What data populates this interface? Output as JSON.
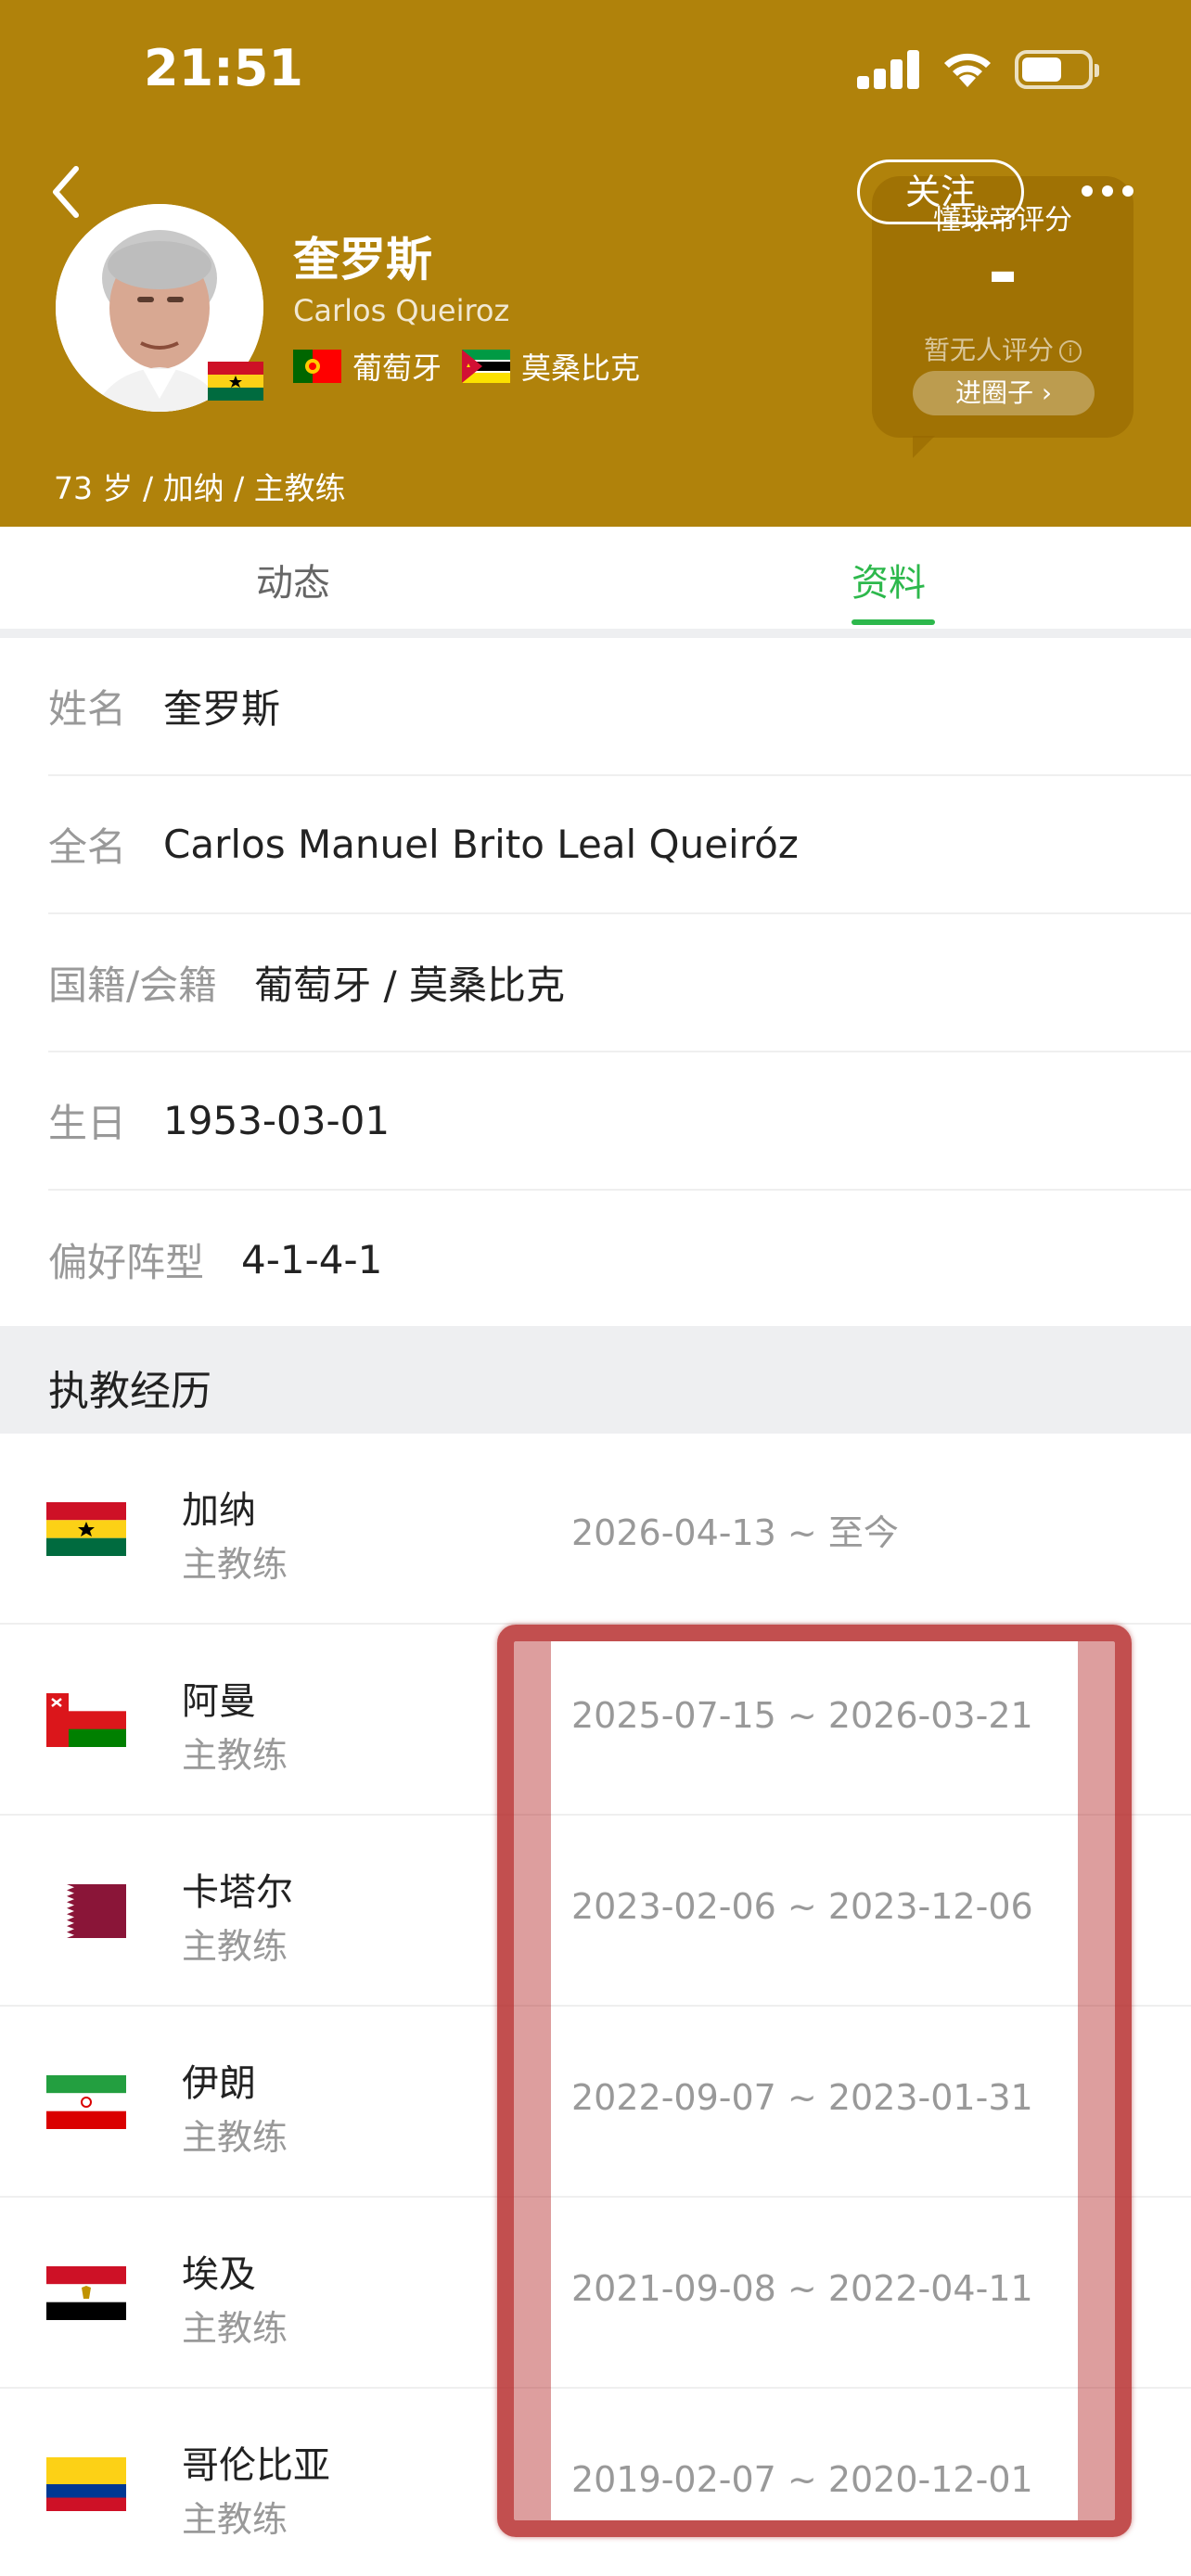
{
  "status_bar": {
    "time": "21:51"
  },
  "profile": {
    "name_cn": "奎罗斯",
    "name_en": "Carlos Queiroz",
    "nationalities": [
      {
        "name": "葡萄牙",
        "flag": "portugal-flag"
      },
      {
        "name": "莫桑比克",
        "flag": "mozambique-flag"
      }
    ],
    "sub_info": "73 岁 / 加纳 / 主教练",
    "follow_label": "关注"
  },
  "rating": {
    "title": "懂球帝评分",
    "value": "-",
    "sub": "暂无人评分",
    "circle_button": "进圈子 ›"
  },
  "tabs": [
    {
      "label": "动态",
      "active": false
    },
    {
      "label": "资料",
      "active": true
    }
  ],
  "info": [
    {
      "label": "姓名",
      "value": "奎罗斯"
    },
    {
      "label": "全名",
      "value": "Carlos Manuel Brito Leal Queiróz"
    },
    {
      "label": "国籍/会籍",
      "value": "葡萄牙 / 莫桑比克"
    },
    {
      "label": "生日",
      "value": "1953-03-01"
    },
    {
      "label": "偏好阵型",
      "value": "4-1-4-1"
    }
  ],
  "career_section": {
    "title": "执教经历"
  },
  "career": [
    {
      "team": "加纳",
      "role": "主教练",
      "period": "2026-04-13 ~ 至今",
      "flag": "ghana-flag"
    },
    {
      "team": "阿曼",
      "role": "主教练",
      "period": "2025-07-15 ~ 2026-03-21",
      "flag": "oman-flag"
    },
    {
      "team": "卡塔尔",
      "role": "主教练",
      "period": "2023-02-06 ~ 2023-12-06",
      "flag": "qatar-flag"
    },
    {
      "team": "伊朗",
      "role": "主教练",
      "period": "2022-09-07 ~ 2023-01-31",
      "flag": "iran-flag"
    },
    {
      "team": "埃及",
      "role": "主教练",
      "period": "2021-09-08 ~ 2022-04-11",
      "flag": "egypt-flag"
    },
    {
      "team": "哥伦比亚",
      "role": "主教练",
      "period": "2019-02-07 ~ 2020-12-01",
      "flag": "colombia-flag"
    }
  ],
  "colors": {
    "header_bg": "#B0820B",
    "accent_green": "#2DB84C",
    "highlight_red": "#B42828"
  }
}
